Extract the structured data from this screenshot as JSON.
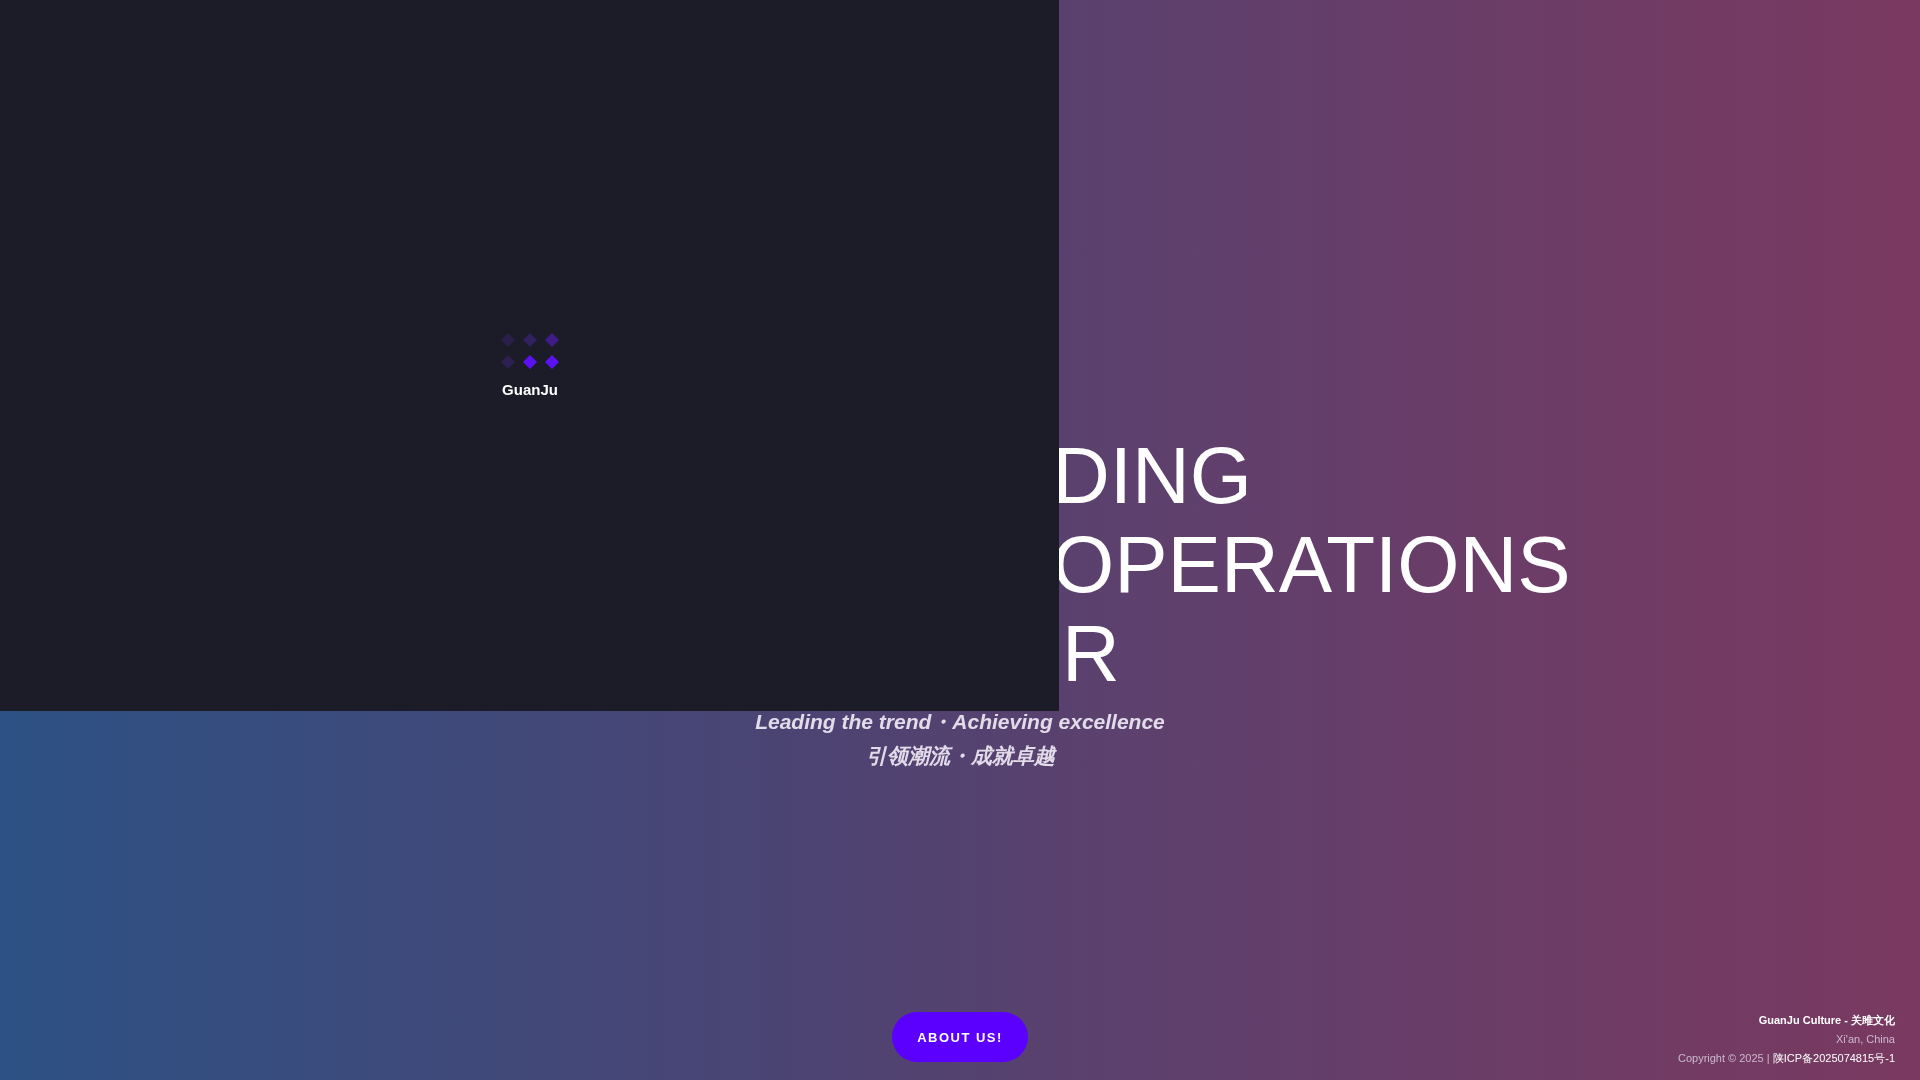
{
  "loader": {
    "label": "GuanJu"
  },
  "hero": {
    "title_lines": [
      "DING",
      "OPERATIONS",
      "R"
    ],
    "taglines": [
      "Leading the trend・Achieving excellence",
      "引领潮流・成就卓越"
    ],
    "button": "ABOUT US!"
  },
  "footer": {
    "company": "GuanJu Culture - 关雎文化",
    "location": "Xi'an, China",
    "copyright": "Copyright © 2025 |",
    "icp_link": "陕ICP备2025074815号-1"
  }
}
